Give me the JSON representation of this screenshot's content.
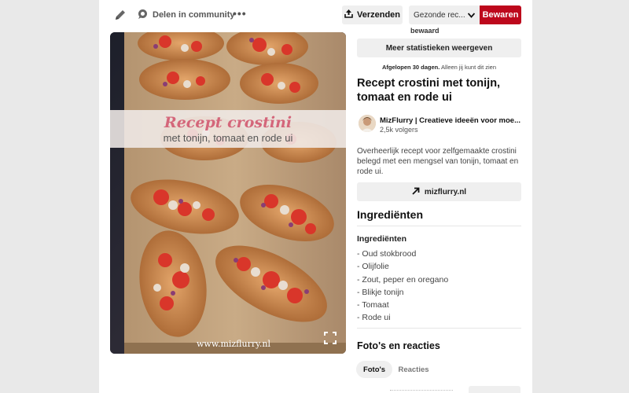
{
  "topbar": {
    "edit_icon": "pencil-icon",
    "share_label": "Delen in community",
    "share_icon": "chat-bubble-icon",
    "more_label": "•••",
    "send_label": "Verzenden",
    "send_icon": "upload-icon",
    "board_value": "Gezonde rec...",
    "save_label": "Bewaren",
    "accent_color": "#bd081c"
  },
  "image": {
    "title_line1": "Recept crostini",
    "title_line2": "met tonijn, tomaat en rode ui",
    "watermark": "www.mizflurry.nl",
    "expand_icon": "expand-icon"
  },
  "stats": {
    "cut_label": "bewaard",
    "more_stats_label": "Meer statistieken weergeven",
    "period_bold": "Afgelopen 30 dagen.",
    "period_note": "Alleen jij kunt dit zien"
  },
  "pin": {
    "title": "Recept crostini met tonijn, tomaat en rode ui",
    "author_name": "MizFlurry | Creatieve ideeën voor moe...",
    "followers": "2,5k volgers",
    "description": "Overheerlijk recept voor zelfgemaakte crostini belegd met een mengsel van tonijn, tomaat en rode ui.",
    "site_label": "mizflurry.nl",
    "site_icon": "arrow-up-right-icon"
  },
  "ingredients": {
    "heading": "Ingrediënten",
    "subheading": "Ingrediënten",
    "items": [
      "- Oud stokbrood",
      "- Olijfolie",
      "- Zout, peper en oregano",
      "- Blikje tonijn",
      "- Tomaat",
      "- Rode ui"
    ]
  },
  "photos": {
    "heading": "Foto's en reacties",
    "tabs": [
      {
        "label": "Foto's"
      },
      {
        "label": "Reacties"
      }
    ]
  }
}
